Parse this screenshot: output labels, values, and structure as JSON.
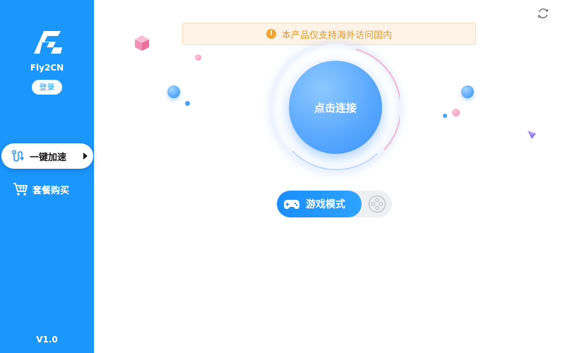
{
  "sidebar": {
    "brand": "Fly2CN",
    "login_label": "登录",
    "nav": [
      {
        "label": "一键加速",
        "active": true,
        "icon": "route-icon"
      },
      {
        "label": "套餐购买",
        "active": false,
        "icon": "cart-icon"
      }
    ],
    "version": "V1.0"
  },
  "notice": {
    "icon": "info-icon",
    "text": "本产品仅支持海外访问国内"
  },
  "main": {
    "connect_label": "点击连接",
    "mode_label": "游戏模式",
    "mode_enabled": true
  },
  "colors": {
    "sidebar": "#1b96fb",
    "accent": "#3f93fb",
    "notice_text": "#e09a2c",
    "notice_bg": "#fdf3e6"
  }
}
